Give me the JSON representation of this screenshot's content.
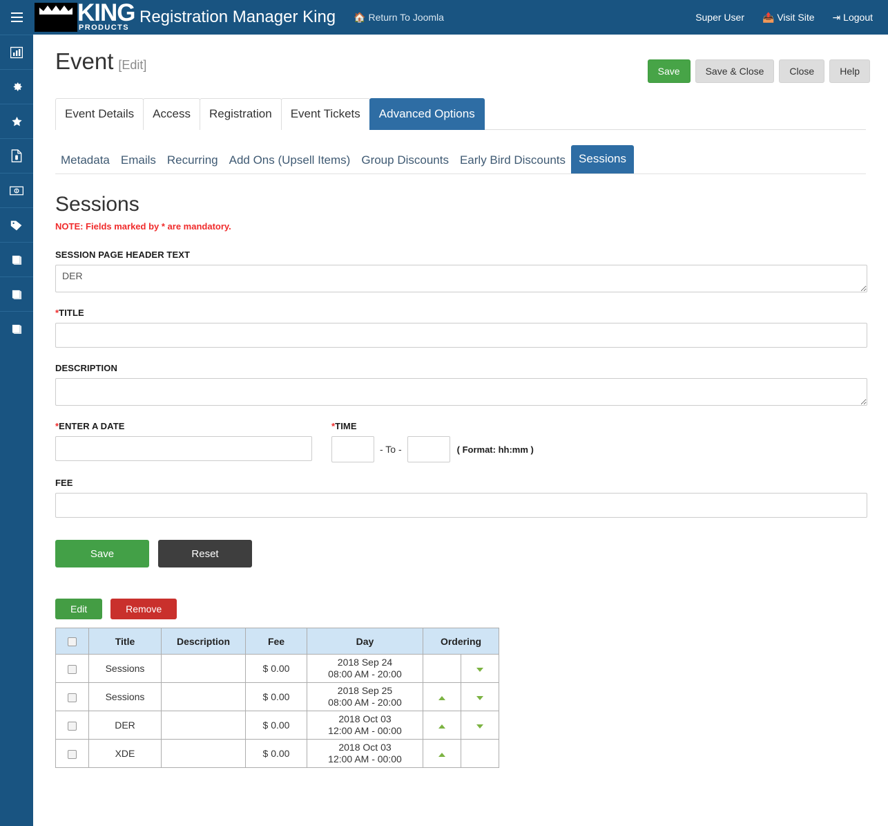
{
  "sidebar": {
    "menu_toggle_label": "☰",
    "items": [
      {
        "name": "dashboard",
        "icon": "bar-chart-icon"
      },
      {
        "name": "settings",
        "icon": "gear-icon"
      },
      {
        "name": "featured",
        "icon": "star-icon"
      },
      {
        "name": "document",
        "icon": "document-icon"
      },
      {
        "name": "payments",
        "icon": "money-icon"
      },
      {
        "name": "tags",
        "icon": "tag-icon"
      },
      {
        "name": "book-1",
        "icon": "book-icon"
      },
      {
        "name": "book-2",
        "icon": "book-icon"
      },
      {
        "name": "book-3",
        "icon": "book-icon"
      }
    ]
  },
  "header": {
    "logo_main": "KING",
    "logo_sub": "PRODUCTS",
    "app_title": "Registration Manager King",
    "return_to_joomla": "Return To Joomla",
    "user": "Super User",
    "visit_site": "Visit Site",
    "logout": "Logout",
    "background_color": "#195481"
  },
  "page": {
    "title": "Event",
    "title_suffix": "[Edit]",
    "toolbar": {
      "save": "Save",
      "save_and_close": "Save & Close",
      "close": "Close",
      "help": "Help",
      "save_color": "#47a447"
    }
  },
  "tabs": {
    "items": [
      {
        "label": "Event Details",
        "active": false
      },
      {
        "label": "Access",
        "active": false
      },
      {
        "label": "Registration",
        "active": false
      },
      {
        "label": "Event Tickets",
        "active": false
      },
      {
        "label": "Advanced Options",
        "active": true
      }
    ],
    "active_color": "#2e6da4"
  },
  "subtabs": {
    "items": [
      {
        "label": "Metadata",
        "active": false
      },
      {
        "label": "Emails",
        "active": false
      },
      {
        "label": "Recurring",
        "active": false
      },
      {
        "label": "Add Ons (Upsell Items)",
        "active": false
      },
      {
        "label": "Group Discounts",
        "active": false
      },
      {
        "label": "Early Bird Discounts",
        "active": false
      },
      {
        "label": "Sessions",
        "active": true
      }
    ]
  },
  "section": {
    "heading": "Sessions",
    "note": "NOTE: Fields marked by * are mandatory.",
    "note_color": "#f02b2b"
  },
  "form": {
    "header_text_label": "SESSION PAGE HEADER TEXT",
    "header_text_value": "DER",
    "title_label_star": "*",
    "title_label": "TITLE",
    "title_value": "",
    "description_label": "DESCRIPTION",
    "description_value": "",
    "date_label_star": "*",
    "date_label": "ENTER A DATE",
    "date_value": "",
    "time_label_star": "*",
    "time_label": "TIME",
    "time_from_value": "",
    "time_to_value": "",
    "time_separator": "- To -",
    "time_format_hint": "( Format: hh:mm )",
    "fee_label": "FEE",
    "fee_value": "",
    "save_button": "Save",
    "reset_button": "Reset"
  },
  "list_actions": {
    "edit": "Edit",
    "remove": "Remove",
    "edit_color": "#449d44",
    "remove_color": "#c9302c"
  },
  "table": {
    "columns": [
      "",
      "Title",
      "Description",
      "Fee",
      "Day",
      "Ordering"
    ],
    "rows": [
      {
        "checked": false,
        "title": "Sessions",
        "description": "",
        "fee": "$ 0.00",
        "day_date": "2018 Sep 24",
        "day_time": "08:00 AM - 20:00",
        "order_up": false,
        "order_down": true
      },
      {
        "checked": false,
        "title": "Sessions",
        "description": "",
        "fee": "$ 0.00",
        "day_date": "2018 Sep 25",
        "day_time": "08:00 AM - 20:00",
        "order_up": true,
        "order_down": true
      },
      {
        "checked": false,
        "title": "DER",
        "description": "",
        "fee": "$ 0.00",
        "day_date": "2018 Oct 03",
        "day_time": "12:00 AM - 00:00",
        "order_up": true,
        "order_down": true
      },
      {
        "checked": false,
        "title": "XDE",
        "description": "",
        "fee": "$ 0.00",
        "day_date": "2018 Oct 03",
        "day_time": "12:00 AM - 00:00",
        "order_up": true,
        "order_down": false
      }
    ]
  }
}
